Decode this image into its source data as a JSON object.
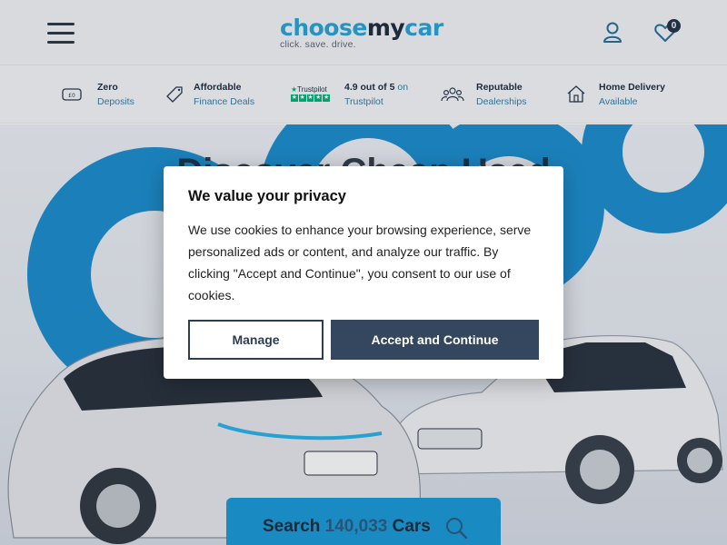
{
  "header": {
    "logo": {
      "part1": "choose",
      "part2": "my",
      "part3": "car",
      "tagline": "click. save. drive."
    },
    "favourites_count": "0"
  },
  "usps": [
    {
      "icon": "coins-icon",
      "title": "Zero",
      "subtitle": "Deposits"
    },
    {
      "icon": "percent-tag-icon",
      "title": "Affordable",
      "subtitle": "Finance Deals"
    },
    {
      "icon": "trustpilot-logo",
      "logo_text": "Trustpilot",
      "rating": "4.9 out of 5",
      "on": "on",
      "subtitle": "Trustpilot"
    },
    {
      "icon": "people-group-icon",
      "title": "Reputable",
      "subtitle": "Dealerships"
    },
    {
      "icon": "house-icon",
      "title": "Home Delivery",
      "subtitle": "Available"
    }
  ],
  "hero": {
    "title_partial": "Discover Cheap Used"
  },
  "search_button": {
    "prefix": "Search",
    "count": "140,033",
    "suffix": "Cars"
  },
  "cookie_modal": {
    "title": "We value your privacy",
    "body": "We use cookies to enhance your browsing experience, serve personalized ads or content, and analyze our traffic. By clicking \"Accept and Continue\", you consent to our use of cookies.",
    "manage_label": "Manage",
    "accept_label": "Accept and Continue"
  },
  "colors": {
    "brand_blue": "#1c9ad8",
    "navy": "#1f2d3d",
    "accept_bg": "#34475e",
    "trustpilot_green": "#00b67a"
  }
}
